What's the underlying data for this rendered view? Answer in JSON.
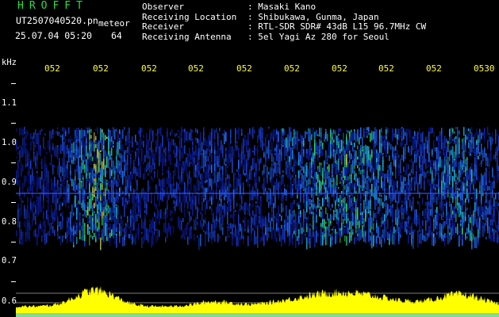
{
  "app": {
    "name": "HROFFT",
    "file_name": "UT2507040520.pn",
    "file_suffix": "meteor",
    "date_time": "25.07.04 05:20",
    "count": "64"
  },
  "info": [
    {
      "label": "Observer",
      "value": ": Masaki Kano"
    },
    {
      "label": "Receiving Location",
      "value": ": Shibukawa, Gunma, Japan"
    },
    {
      "label": "Receiver",
      "value": ": RTL-SDR SDR# 43dB L15 96.7MHz CW"
    },
    {
      "label": "Receiving Antenna",
      "value": ": 5el Yagi Az 280 for Seoul"
    }
  ],
  "axis": {
    "unit": "kHz",
    "labels": [
      "1.1",
      "1.0",
      "0.9",
      "0.8",
      "0.7",
      "0.6"
    ]
  },
  "timeline": [
    "052",
    "052",
    "052",
    "052",
    "052",
    "052",
    "052",
    "052",
    "052",
    "0530"
  ],
  "colors": {
    "brand": "#22e040",
    "text": "#ffffff",
    "timeline": "#ffff33",
    "signal": "#ffff00",
    "background": "#000000"
  }
}
